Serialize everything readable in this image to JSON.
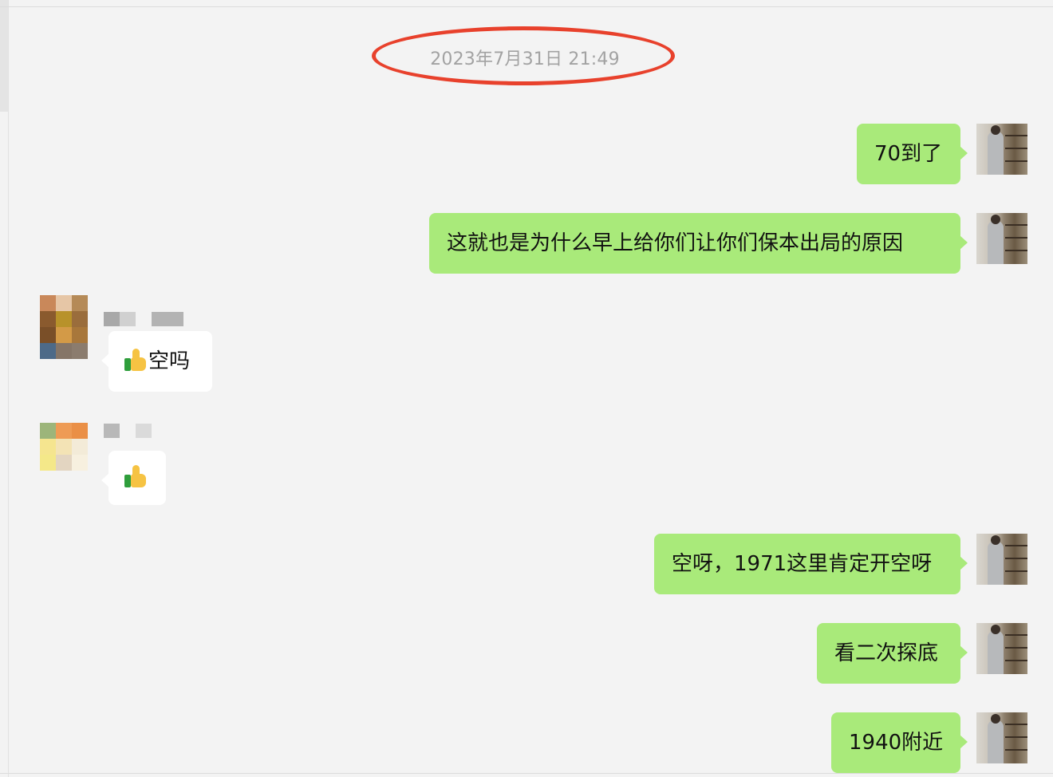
{
  "timestamp": "2023年7月31日 21:49",
  "messages": [
    {
      "side": "me",
      "text": "70到了"
    },
    {
      "side": "me",
      "text": "这就也是为什么早上给你们让你们保本出局的原因"
    },
    {
      "side": "other",
      "text": "空吗",
      "emoji": "thumbs-up"
    },
    {
      "side": "other",
      "text": "",
      "emoji": "thumbs-up"
    },
    {
      "side": "me",
      "text": "空呀，1971这里肯定开空呀"
    },
    {
      "side": "me",
      "text": "看二次探底"
    },
    {
      "side": "me",
      "text": "1940附近"
    }
  ],
  "colors": {
    "background": "#f3f3f3",
    "my_bubble": "#a9ea7a",
    "other_bubble": "#ffffff",
    "timestamp_text": "#a2a2a2",
    "highlight_circle": "#e8412c"
  }
}
